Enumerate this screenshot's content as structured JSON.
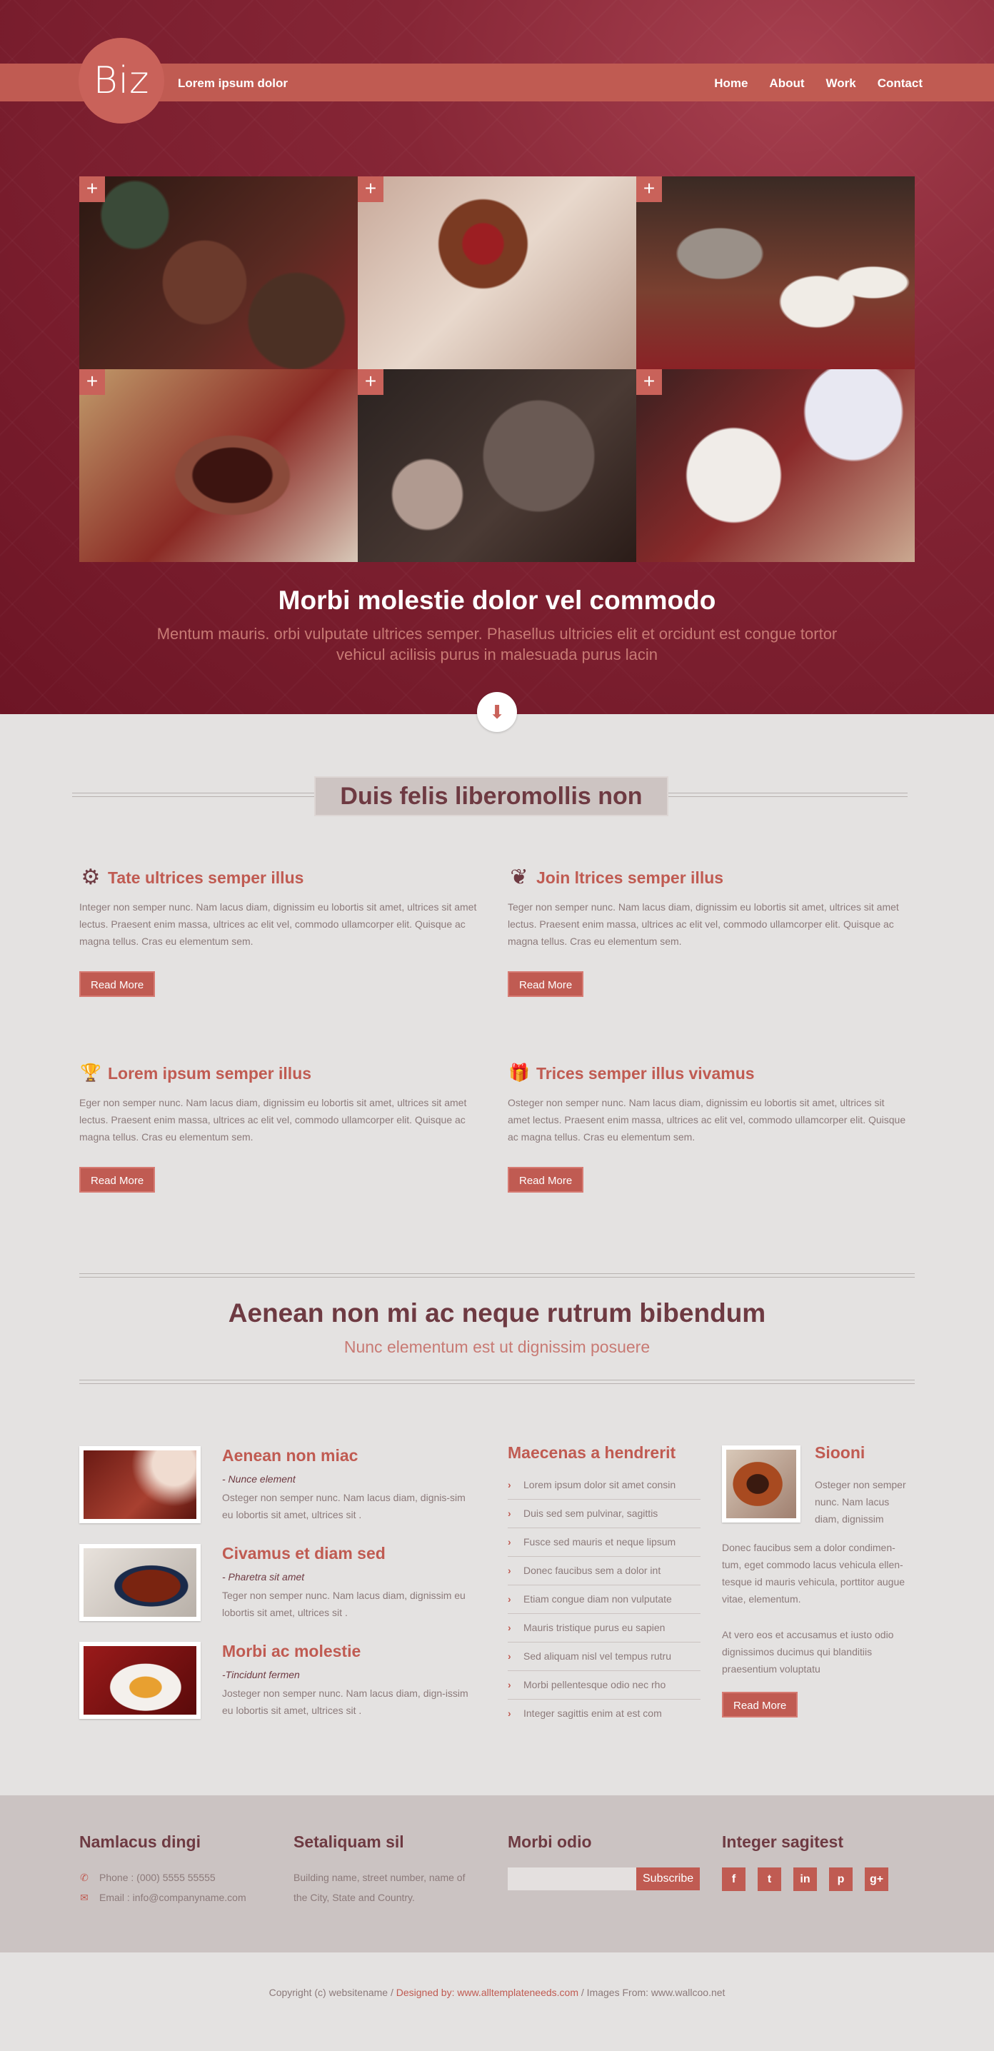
{
  "header": {
    "logo": "Biz",
    "tagline": "Lorem ipsum dolor",
    "nav": [
      "Home",
      "About",
      "Work",
      "Contact"
    ]
  },
  "gallery": {
    "plus": "+",
    "count": 6
  },
  "hero": {
    "title": "Morbi molestie dolor vel commodo",
    "subtitle": "Mentum mauris. orbi vulputate ultrices semper. Phasellus ultricies elit et orcidunt est congue tortor vehicul acilisis purus in malesuada purus lacin",
    "down_icon": "⬇"
  },
  "section1": {
    "title": "Duis felis liberomollis non",
    "features": [
      {
        "icon": "gear-icon",
        "glyph": "⚙",
        "title": "Tate ultrices semper illus",
        "text": "Integer non semper nunc. Nam lacus diam, dignissim eu lobortis sit amet, ultrices sit amet lectus. Praesent enim massa, ultrices ac elit vel, commodo ullamcorper elit. Quisque ac magna tellus. Cras eu elementum sem.",
        "button": "Read More"
      },
      {
        "icon": "leaf-icon",
        "glyph": "❦",
        "title": "Join ltrices semper illus",
        "text": "Teger non semper nunc. Nam lacus diam, dignissim eu lobortis sit amet, ultrices sit amet lectus. Praesent enim massa, ultrices ac elit vel, commodo ullamcorper elit. Quisque ac magna tellus. Cras eu elementum sem.",
        "button": "Read More"
      },
      {
        "icon": "trophy-icon",
        "glyph": "🏆",
        "title": "Lorem ipsum semper illus",
        "text": "Eger non semper nunc. Nam lacus diam, dignissim eu lobortis sit amet, ultrices sit amet lectus. Praesent enim massa, ultrices ac elit vel, commodo ullamcorper elit. Quisque ac magna tellus. Cras eu elementum sem.",
        "button": "Read More"
      },
      {
        "icon": "gift-icon",
        "glyph": "🎁",
        "title": "Trices semper illus vivamus",
        "text": "Osteger non semper nunc. Nam lacus diam, dignissim eu lobortis sit amet, ultrices sit amet lectus. Praesent enim massa, ultrices ac elit vel, commodo ullamcorper elit. Quisque ac magna tellus. Cras eu elementum sem.",
        "button": "Read More"
      }
    ]
  },
  "section2": {
    "title": "Aenean non mi ac neque rutrum bibendum",
    "subtitle": "Nunc elementum est ut dignissim posuere"
  },
  "posts": [
    {
      "title": "Aenean non miac",
      "sub": "- Nunce element",
      "text": "Osteger non semper nunc. Nam lacus diam, dignis-sim eu lobortis sit amet, ultrices sit ."
    },
    {
      "title": "Civamus et diam sed",
      "sub": "- Pharetra sit amet",
      "text": "Teger non semper nunc. Nam lacus diam, dignissim eu lobortis sit amet, ultrices sit ."
    },
    {
      "title": "Morbi ac molestie",
      "sub": "-Tincidunt fermen",
      "text": "Josteger non semper nunc. Nam lacus diam, dign-issim eu lobortis sit amet, ultrices sit ."
    }
  ],
  "links": {
    "title": "Maecenas a hendrerit",
    "items": [
      "Lorem ipsum dolor sit amet consin",
      "Duis sed sem pulvinar, sagittis",
      "Fusce sed mauris et neque lipsum",
      "Donec faucibus sem a dolor int",
      "Etiam congue diam non vulputate",
      "Mauris tristique purus eu sapien",
      "Sed aliquam nisl vel tempus rutru",
      "Morbi pellentesque odio nec rho",
      "Integer sagittis enim at est com"
    ]
  },
  "side": {
    "title": "Siooni",
    "text1": "Osteger non semper nunc. Nam lacus diam, dignissim",
    "text2": "Donec faucibus sem a dolor condimen-tum, eget commodo lacus vehicula ellen-tesque id mauris vehicula, porttitor augue vitae, elementum.",
    "text3": "At vero eos et accusamus et iusto odio dignissimos ducimus qui blanditiis praesentium voluptatu",
    "button": "Read More"
  },
  "footer": {
    "col1": {
      "title": "Namlacus dingi",
      "phone": "Phone : (000)  5555 55555",
      "email": "Email : info@companyname.com"
    },
    "col2": {
      "title": "Setaliquam sil",
      "address": "Building name, street number, name of the City, State and Country."
    },
    "col3": {
      "title": "Morbi odio",
      "subscribe": "Subscribe"
    },
    "col4": {
      "title": "Integer sagitest",
      "socials": [
        "f",
        "t",
        "in",
        "p",
        "g+"
      ]
    }
  },
  "copyright": {
    "part1": "Copyright (c) websitename / ",
    "part2": "Designed by: www.alltemplateneeds.com",
    "part3": " / Images From: www.wallcoo.net"
  },
  "colors": {
    "accent": "#c05b52",
    "dark": "#6e3a42",
    "hero": "#862636"
  }
}
